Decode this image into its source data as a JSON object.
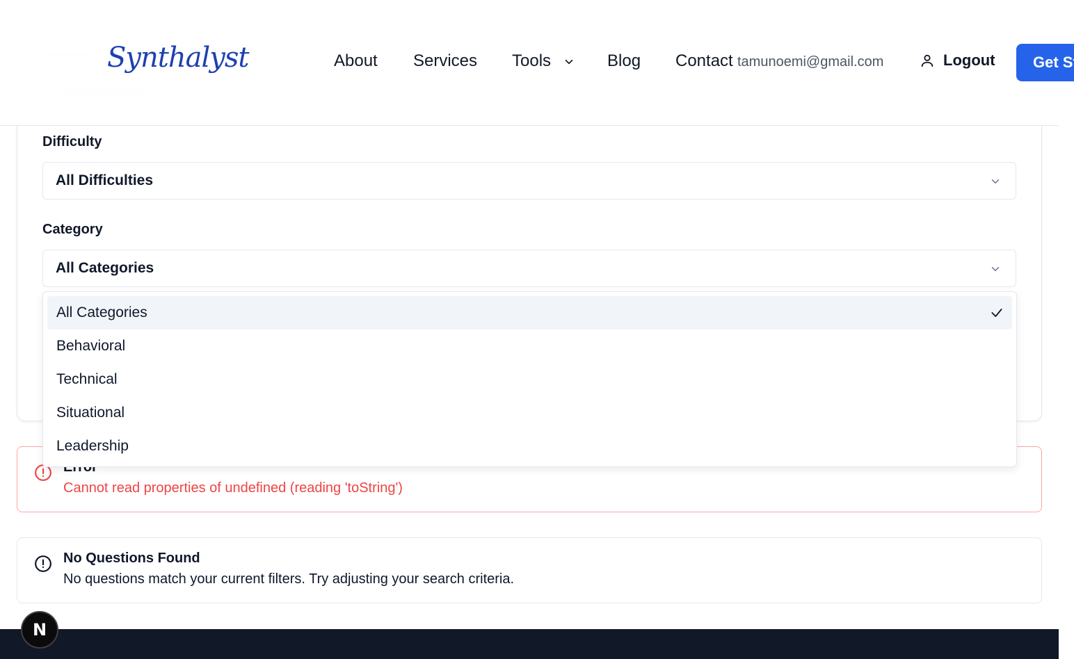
{
  "header": {
    "logo": "Synthalyst",
    "nav": [
      {
        "label": "About"
      },
      {
        "label": "Services"
      },
      {
        "label": "Tools"
      },
      {
        "label": "Blog"
      },
      {
        "label": "Contact"
      }
    ],
    "user_email": "tamunoemi@gmail.com",
    "logout_label": "Logout",
    "cta_label": "Get St"
  },
  "filters": {
    "difficulty_label": "Difficulty",
    "difficulty_value": "All Difficulties",
    "category_label": "Category",
    "category_value": "All Categories"
  },
  "category_dropdown": {
    "options": [
      "All Categories",
      "Behavioral",
      "Technical",
      "Situational",
      "Leadership"
    ],
    "selected": "All Categories"
  },
  "error_alert": {
    "title": "Error",
    "message": "Cannot read properties of undefined (reading 'toString')"
  },
  "empty_alert": {
    "title": "No Questions Found",
    "message": "No questions match your current filters. Try adjusting your search criteria."
  },
  "dev_badge": "N",
  "colors": {
    "brand": "#1e40af",
    "cta": "#2563eb",
    "error": "#ef4444",
    "footer": "#111827"
  }
}
